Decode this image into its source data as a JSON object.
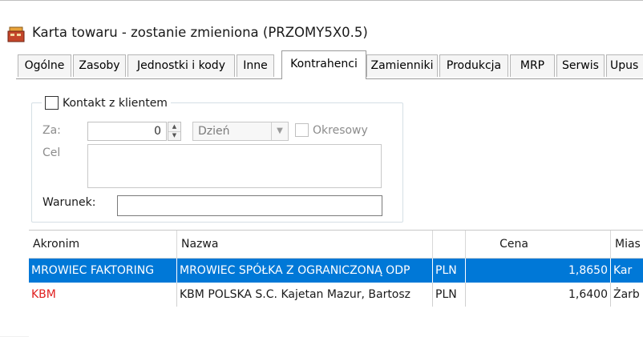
{
  "window": {
    "title": "Karta towaru - zostanie zmieniona (PRZOMY5X0.5)",
    "icon": "product-card-icon"
  },
  "tabs": [
    {
      "label": "Ogólne",
      "active": false
    },
    {
      "label": "Zasoby",
      "active": false
    },
    {
      "label": "Jednostki i kody",
      "active": false
    },
    {
      "label": "Inne",
      "active": false
    },
    {
      "label": "Kontrahenci",
      "active": true
    },
    {
      "label": "Zamienniki",
      "active": false
    },
    {
      "label": "Produkcja",
      "active": false
    },
    {
      "label": "MRP",
      "active": false
    },
    {
      "label": "Serwis",
      "active": false
    },
    {
      "label": "Upus",
      "active": false
    }
  ],
  "contact": {
    "checkbox_label": "Kontakt z klientem",
    "checked": false,
    "za_label": "Za:",
    "za_value": "0",
    "period_value": "Dzień",
    "okresowy_label": "Okresowy",
    "okresowy_checked": false,
    "cel_label": "Cel",
    "cel_value": "",
    "warunek_label": "Warunek:",
    "warunek_value": ""
  },
  "grid": {
    "columns": [
      "Akronim",
      "Nazwa",
      "",
      "Cena",
      "Mias"
    ],
    "rows": [
      {
        "akronim": "MROWIEC FAKTORING",
        "nazwa": "MROWIEC SPÓŁKA Z OGRANICZONĄ ODP",
        "waluta": "PLN",
        "cena": "1,8650",
        "miasto": "Kar",
        "selected": true,
        "red": false
      },
      {
        "akronim": "KBM",
        "nazwa": "KBM POLSKA S.C. Kajetan Mazur, Bartosz",
        "waluta": "PLN",
        "cena": "1,6400",
        "miasto": "Żarb",
        "selected": false,
        "red": true
      }
    ]
  },
  "colors": {
    "selection": "#0078d7",
    "red_text": "#e02020"
  }
}
